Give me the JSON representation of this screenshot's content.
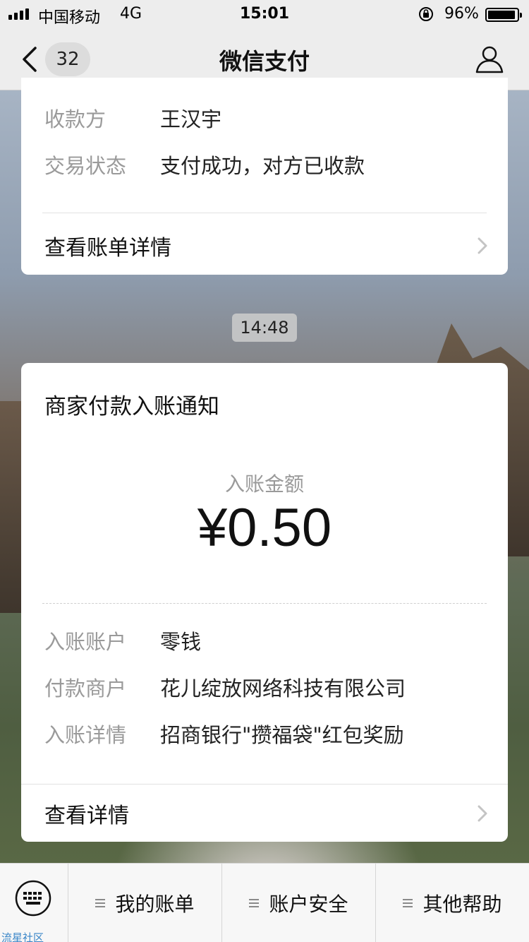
{
  "status_bar": {
    "carrier": "中国移动",
    "network": "4G",
    "time": "15:01",
    "battery": "96%"
  },
  "nav": {
    "back_count": "32",
    "title": "微信支付"
  },
  "card1": {
    "rows": [
      {
        "key": "收款方",
        "value": "王汉宇"
      },
      {
        "key": "交易状态",
        "value": "支付成功，对方已收款"
      }
    ],
    "link_label": "查看账单详情"
  },
  "timestamp": "14:48",
  "card2": {
    "title": "商家付款入账通知",
    "amount_label": "入账金额",
    "amount": "¥0.50",
    "rows": [
      {
        "key": "入账账户",
        "value": "零钱"
      },
      {
        "key": "付款商户",
        "value": "花儿绽放网络科技有限公司"
      },
      {
        "key": "入账详情",
        "value": "招商银行\"攒福袋\"红包奖励"
      }
    ],
    "link_label": "查看详情"
  },
  "bottom_menu": {
    "watermark": "流星社区",
    "items": [
      {
        "label": "我的账单",
        "icon": "menu-list-icon"
      },
      {
        "label": "账户安全",
        "icon": "menu-list-icon"
      },
      {
        "label": "其他帮助",
        "icon": "menu-list-icon"
      }
    ]
  },
  "colors": {
    "nav_bg": "#ededed",
    "card_bg": "#ffffff",
    "label_gray": "#9a9a9a"
  }
}
